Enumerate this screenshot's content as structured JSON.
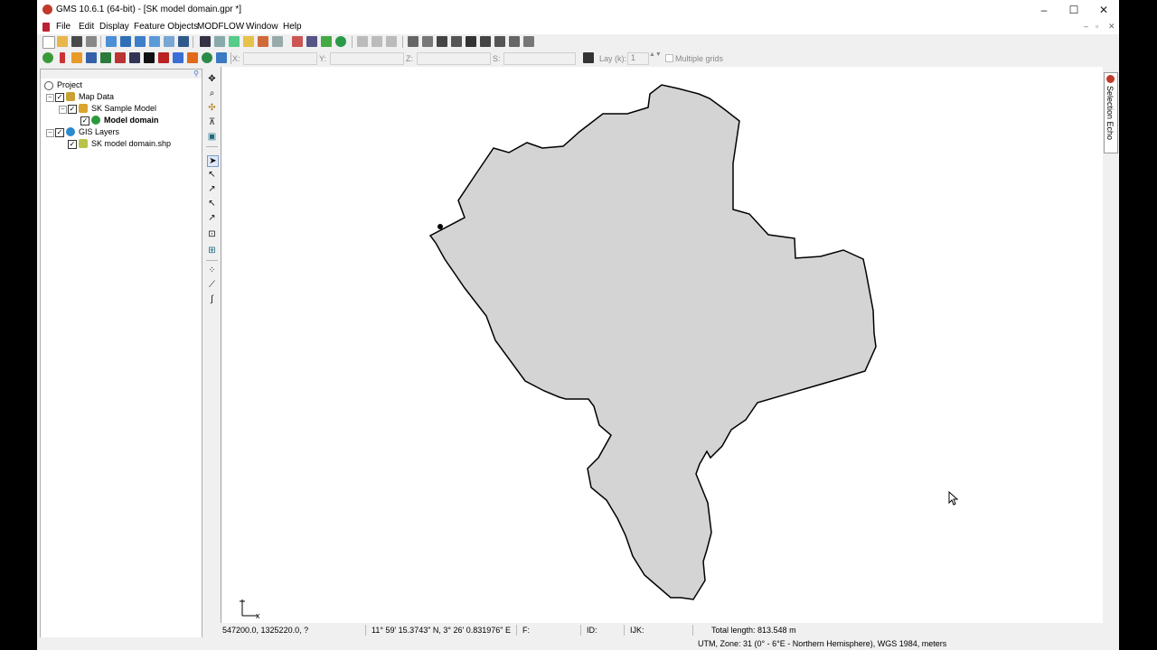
{
  "window": {
    "title": "GMS 10.6.1 (64-bit) - [SK model domain.gpr *]",
    "controls": {
      "minimize": "–",
      "maximize": "☐",
      "close": "✕"
    }
  },
  "menu": [
    "File",
    "Edit",
    "Display",
    "Feature Objects",
    "MODFLOW",
    "Window",
    "Help"
  ],
  "coord_fields": {
    "x_label": "X:",
    "y_label": "Y:",
    "z_label": "Z:",
    "s_label": "S:"
  },
  "lay_field": {
    "label": "Lay (k):",
    "value": "1"
  },
  "multiple_grids": {
    "label": "Multiple grids",
    "checked": false
  },
  "tree": {
    "project": "Project",
    "map_data": "Map Data",
    "sk_sample_model": "SK Sample Model",
    "model_domain": "Model domain",
    "gis_layers": "GIS Layers",
    "shapefile": "SK model domain.shp"
  },
  "selection_echo": "Selection Echo",
  "axis_triad": {
    "x": "x"
  },
  "status": {
    "coords": "547200.0, 1325220.0, ?",
    "latlon": "11° 59' 15.3743\" N, 3° 26' 0.831976\" E",
    "f": "F:",
    "id": "ID:",
    "ijk": "IJK:",
    "total_length": "Total length: 813.548 m",
    "projection": "UTM,  Zone: 31 (0° - 6°E - Northern Hemisphere),  WGS 1984,  meters"
  },
  "colors": {
    "polygon_fill": "#d4d4d4",
    "polygon_stroke": "#000000",
    "accent": "#3b6fd6"
  }
}
